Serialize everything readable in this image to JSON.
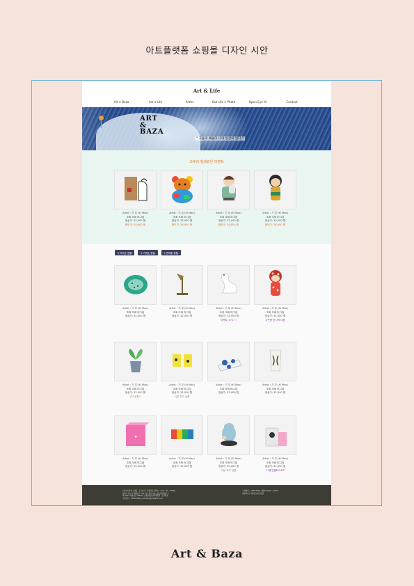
{
  "page_title": "아트플랫폼 쇼핑몰 디자인 시안",
  "brand_footer": "Art & Baza",
  "site": {
    "logo": "Art & Life",
    "nav": [
      "Art n Baza",
      "Art n Life",
      "Artist",
      "Out Life n Photo",
      "Open Eye AI",
      "Contact"
    ],
    "hero": {
      "title": "ART\n&\nBAZA",
      "subtitle": "\" 그들의 예술이 나의 일상이 된다 \""
    },
    "event": {
      "title": "오후의 행쇄같은 이벤트",
      "products": [
        {
          "artist": "Artist : 기 무 (Ki Moo)",
          "name": "조화 조화 머그컵",
          "price": "정상가: 32,000 원",
          "sale": "할인가: 28,800 원",
          "icon": "bag-icon"
        },
        {
          "artist": "Artist : 기 무 (Ki Moo)",
          "name": "조화 조화 머그컵",
          "price": "정상가: 32,000 원",
          "sale": "할인가: 28,800 원",
          "icon": "bear-icon"
        },
        {
          "artist": "Artist : 기 무 (Ki Moo)",
          "name": "조화 조화 머그컵",
          "price": "정상가: 32,000 원",
          "sale": "할인가: 28,800 원",
          "icon": "figure-icon"
        },
        {
          "artist": "Artist : 기 무 (Ki Moo)",
          "name": "조화 조화 머그컵",
          "price": "정상가: 32,000 원",
          "sale": "할인가: 28,800 원",
          "icon": "doll-icon"
        }
      ]
    },
    "filters": [
      "작가순 정렬",
      "가격순 정렬",
      "판매량 정렬"
    ],
    "rows": [
      [
        {
          "artist": "Artist : 기 무 (Ki Moo)",
          "name": "조화 조화 머그컵",
          "price": "정상가: 32,000 원",
          "tag": "",
          "icon": "plate-icon"
        },
        {
          "artist": "Artist : 기 무 (Ki Moo)",
          "name": "조화 조화 머그컵",
          "price": "정상가: 32,000 원",
          "tag": "",
          "icon": "lamp-icon"
        },
        {
          "artist": "Artist : 기 무 (Ki Moo)",
          "name": "조화 조화 머그컵",
          "price": "정상가: 32,000 원",
          "tag": "이벤트 1+1 !!",
          "icon": "swan-icon"
        },
        {
          "artist": "Artist : 기 무 (Ki Moo)",
          "name": "조화 조화 머그컵",
          "price": "정상가: 32,000 원",
          "tag": "시즌용 한시적 대량",
          "icon": "kokeshi-icon"
        }
      ],
      [
        {
          "artist": "Artist : 기 무 (Ki Moo)",
          "name": "조화 조화 머그컵",
          "price": "정상가: 32,000 원",
          "tag": "인기상품!!",
          "icon": "plant-icon"
        },
        {
          "artist": "Artist : 기 무 (Ki Moo)",
          "name": "조화 조화 머그컵",
          "price": "정상가: 32,000 원",
          "tag": "이달 우수 상품",
          "icon": "cups-icon"
        },
        {
          "artist": "Artist : 기 무 (Ki Moo)",
          "name": "조화 조화 머그컵",
          "price": "정상가: 32,000 원",
          "tag": "",
          "icon": "tray-icon"
        },
        {
          "artist": "Artist : 기 무 (Ki Moo)",
          "name": "조화 조화 머그컵",
          "price": "정상가: 32,000 원",
          "tag": "",
          "icon": "vase-icon"
        }
      ],
      [
        {
          "artist": "Artist : 기 무 (Ki Moo)",
          "name": "조화 조화 머그컵",
          "price": "정상가: 32,000 원",
          "tag": "",
          "icon": "pink-box-icon"
        },
        {
          "artist": "Artist : 기 무 (Ki Moo)",
          "name": "조화 조화 머그컵",
          "price": "정상가: 32,000 원",
          "tag": "",
          "icon": "love-icon"
        },
        {
          "artist": "Artist : 기 무 (Ki Moo)",
          "name": "조화 조화 머그컵",
          "price": "정상가: 32,000 원",
          "tag": "이달 최고 상품",
          "icon": "hippo-icon"
        },
        {
          "artist": "Artist : 기 무 (Ki Moo)",
          "name": "조화 조화 머그컵",
          "price": "정상가: 32,000 원",
          "tag": "12월건물EVENT",
          "icon": "gift-bag-icon"
        }
      ]
    ],
    "footer": {
      "left": [
        "(주)아트바자 | 대표 : 홍 아 트 | 사업자등록번호 : 123 - 45 - 67890",
        "서울시 강남구 테헤란로 123, 아트빌딩 5층 | 통신판매업신고",
        "제 2023-서울강남-0000호 | 개인정보관리책임자 : 김 예 술",
        "고객센터 : 1588-0000 | artbaza@artbaza.co.kr"
      ],
      "right": [
        "고객센터 : 1588-0000 | 평일 10:00 - 18:00",
        "이용약관 | 개인정보처리방침"
      ]
    }
  },
  "colors": {
    "background": "#f5e3dc",
    "frame": "#6ab7d8",
    "event_bg": "#e9f6f1",
    "sale": "#e2703a",
    "tag": "#8a3fb0",
    "filter": "#3d4060",
    "footer": "#3d3d36"
  }
}
